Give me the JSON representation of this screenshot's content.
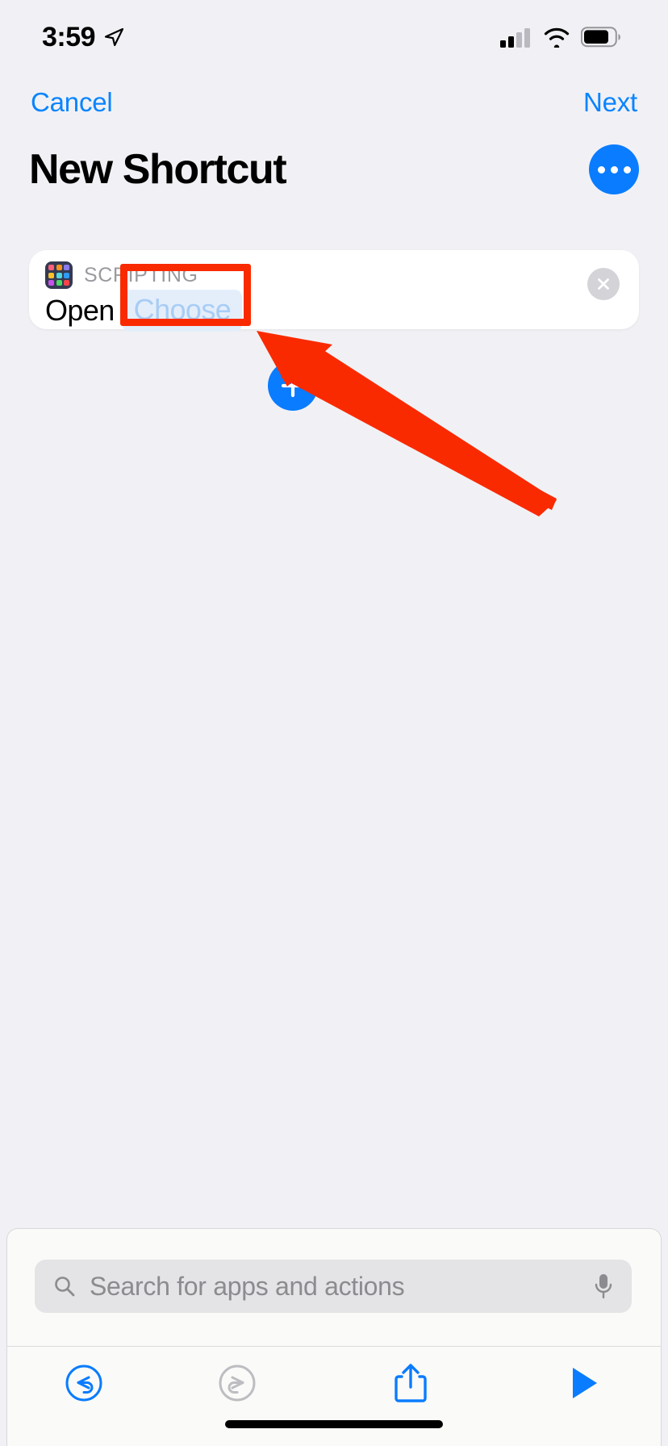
{
  "status_bar": {
    "time": "3:59",
    "location_icon": "location-arrow-icon",
    "cellular_icon": "cellular-signal-icon",
    "cellular_bars_filled": 2,
    "cellular_bars_total": 4,
    "wifi_icon": "wifi-icon",
    "battery_icon": "battery-icon",
    "battery_level_percent": 78
  },
  "nav": {
    "cancel_label": "Cancel",
    "next_label": "Next",
    "accent_color": "#0A84FF"
  },
  "header": {
    "title": "New Shortcut",
    "more_button_icon": "ellipsis-icon",
    "more_button_color": "#0A7CFF"
  },
  "action_card": {
    "category": "SCRIPTING",
    "category_icon": "scripting-app-grid-icon",
    "icon_colors": [
      "#FF5F78",
      "#F7941E",
      "#8B7BEE",
      "#F9C228",
      "#4FD8E0",
      "#2E9BF7",
      "#C654E8",
      "#4CD964",
      "#F9444C"
    ],
    "icon_background": "#343A52",
    "verb": "Open",
    "parameter_label": "Choose",
    "parameter_color": "#A8CDF5",
    "parameter_background": "#E4EEFB",
    "close_icon": "close-x-icon"
  },
  "add_button": {
    "icon": "plus-icon",
    "color": "#0A7CFF"
  },
  "annotation": {
    "highlight_color": "#FA2A00",
    "arrow_icon": "pointer-arrow-icon",
    "target": "Choose"
  },
  "search": {
    "placeholder": "Search for apps and actions",
    "search_icon": "search-icon",
    "mic_icon": "microphone-icon"
  },
  "toolbar": {
    "items": [
      {
        "name": "undo",
        "icon": "undo-arrow-icon",
        "enabled": true,
        "color": "#0A7CFF"
      },
      {
        "name": "redo",
        "icon": "redo-arrow-icon",
        "enabled": false,
        "color": "#BDBDC2"
      },
      {
        "name": "share",
        "icon": "share-icon",
        "enabled": true,
        "color": "#0A7CFF"
      },
      {
        "name": "run",
        "icon": "play-icon",
        "enabled": true,
        "color": "#0A7CFF"
      }
    ]
  },
  "home_indicator": {
    "icon": "home-indicator-bar"
  }
}
